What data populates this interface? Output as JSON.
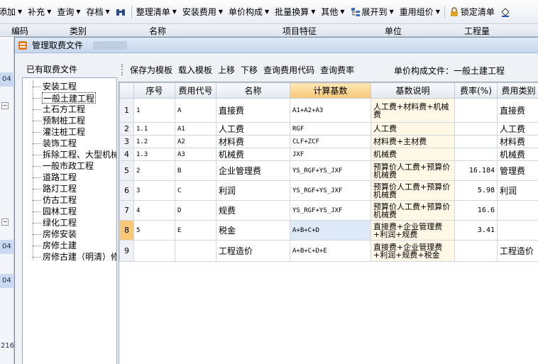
{
  "toolbar": {
    "items": [
      {
        "label": "添加",
        "caret": true
      },
      {
        "label": "补充",
        "caret": true
      },
      {
        "label": "查询",
        "caret": true
      },
      {
        "label": "存档",
        "caret": true
      },
      {
        "label": "整理清单",
        "caret": true
      },
      {
        "label": "安装费用",
        "caret": true
      },
      {
        "label": "单价构成",
        "caret": true
      },
      {
        "label": "批量换算",
        "caret": true
      },
      {
        "label": "其他",
        "caret": true
      },
      {
        "label": "展开到",
        "caret": true
      },
      {
        "label": "重用组价",
        "caret": true
      },
      {
        "label": "锁定清单",
        "caret": false
      }
    ]
  },
  "bg_header": {
    "code": "编码",
    "category": "类别",
    "name": "名称",
    "feature": "项目特征",
    "unit": "单位",
    "quantity": "工程量"
  },
  "bg_left": {
    "row1": "04",
    "row2": "04",
    "row3": "04",
    "num": "216"
  },
  "dialog": {
    "title": "管理取费文件",
    "tree_label": "已有取费文件",
    "unit_file_label": "单价构成文件：一般土建工程",
    "tree_items": [
      "安装工程",
      "一般土建工程",
      "土石方工程",
      "预制桩工程",
      "灌注桩工程",
      "装饰工程",
      "拆除工程、大型机械",
      "一般市政工程",
      "道路工程",
      "路灯工程",
      "仿古工程",
      "园林工程",
      "绿化工程",
      "房修安装",
      "房修土建",
      "房修古建（明清）修"
    ],
    "selected_tree_index": 1,
    "actions": {
      "save_template": "保存为模板",
      "load_template": "载入模板",
      "move_up": "上移",
      "move_down": "下移",
      "query_code": "查询费用代码",
      "query_rate": "查询费率"
    }
  },
  "grid": {
    "headers": [
      "序号",
      "费用代号",
      "名称",
      "计算基数",
      "基数说明",
      "费率(%)",
      "费用类别"
    ],
    "rows": [
      {
        "n": "1",
        "seq": "1",
        "code": "A",
        "name": "直接费",
        "base": "A1+A2+A3",
        "desc": "人工费+材料费+机械费",
        "rate": "",
        "cat": "直接费"
      },
      {
        "n": "2",
        "seq": "1.1",
        "code": "A1",
        "name": "人工费",
        "base": "RGF",
        "desc": "人工费",
        "rate": "",
        "cat": "人工费"
      },
      {
        "n": "3",
        "seq": "1.2",
        "code": "A2",
        "name": "材料费",
        "base": "CLF+ZCF",
        "desc": "材料费+主材费",
        "rate": "",
        "cat": "材料费"
      },
      {
        "n": "4",
        "seq": "1.3",
        "code": "A3",
        "name": "机械费",
        "base": "JXF",
        "desc": "机械费",
        "rate": "",
        "cat": "机械费"
      },
      {
        "n": "5",
        "seq": "2",
        "code": "B",
        "name": "企业管理费",
        "base": "YS_RGF+YS_JXF",
        "desc": "预算价人工费+预算价机械费",
        "rate": "16.184",
        "cat": "管理费"
      },
      {
        "n": "6",
        "seq": "3",
        "code": "C",
        "name": "利润",
        "base": "YS_RGF+YS_JXF",
        "desc": "预算价人工费+预算价机械费",
        "rate": "5.98",
        "cat": "利润"
      },
      {
        "n": "7",
        "seq": "4",
        "code": "D",
        "name": "规费",
        "base": "YS_RGF+YS_JXF",
        "desc": "预算价人工费+预算价机械费",
        "rate": "16.6",
        "cat": ""
      },
      {
        "n": "8",
        "seq": "5",
        "code": "E",
        "name": "税金",
        "base": "A+B+C+D",
        "desc": "直接费+企业管理费+利润+规费",
        "rate": "3.41",
        "cat": ""
      },
      {
        "n": "9",
        "seq": "",
        "code": "",
        "name": "工程造价",
        "base": "A+B+C+D+E",
        "desc": "直接费+企业管理费+利润+规费+税金",
        "rate": "",
        "cat": "工程造价"
      }
    ],
    "selected_row_index": 7
  },
  "colors": {
    "header_highlight": "#f8c878",
    "selected_cell": "#dde9f7",
    "desc_column": "#fff8e6"
  }
}
